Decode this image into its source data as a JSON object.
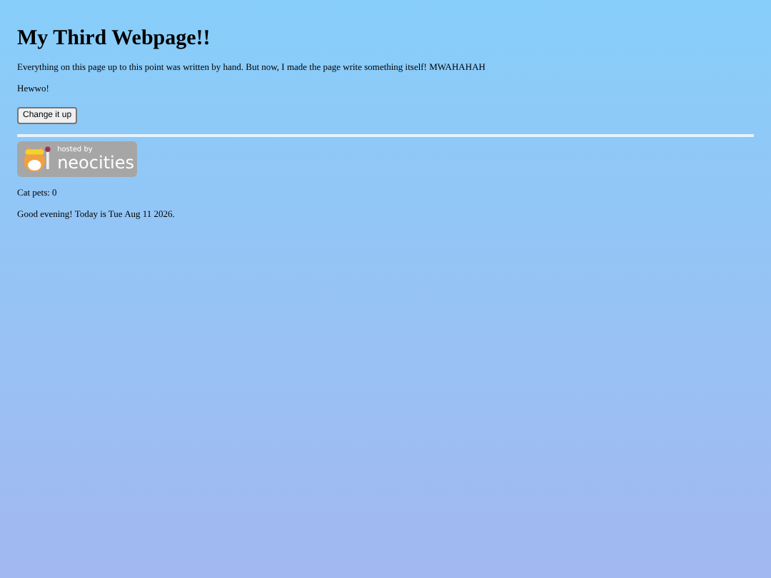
{
  "heading": "My Third Webpage!!",
  "paragraphs": [
    "Everything on this page up to this point was written by hand. But now, I made the page write something itself! MWAHAHAH",
    "Hewwo!"
  ],
  "button": "Change it up",
  "badge": {
    "line_1": "hosted by",
    "line_2": "neocities"
  },
  "lines": [
    "Cat pets: 0",
    "Good evening! Today is Tue Aug 11 2026."
  ]
}
